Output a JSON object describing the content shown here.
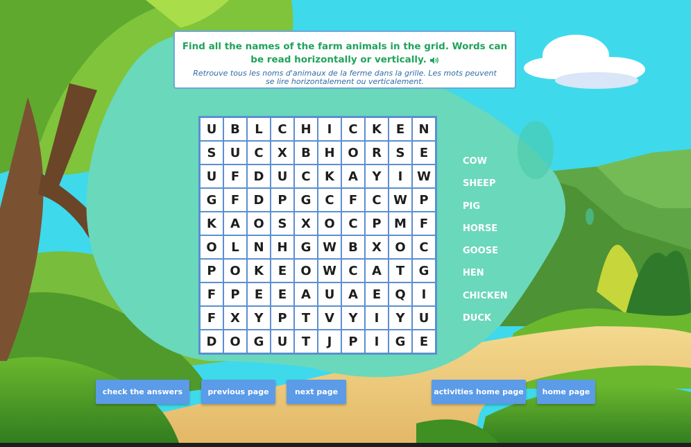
{
  "instructions": {
    "english": "Find all the names of the farm animals in the grid. Words can be read horizontally or vertically.",
    "french": "Retrouve tous les noms d'animaux de la ferme dans la grille. Les mots peuvent se lire horizontalement ou verticalement."
  },
  "grid": [
    [
      "U",
      "B",
      "L",
      "C",
      "H",
      "I",
      "C",
      "K",
      "E",
      "N"
    ],
    [
      "S",
      "U",
      "C",
      "X",
      "B",
      "H",
      "O",
      "R",
      "S",
      "E"
    ],
    [
      "U",
      "F",
      "D",
      "U",
      "C",
      "K",
      "A",
      "Y",
      "I",
      "W"
    ],
    [
      "G",
      "F",
      "D",
      "P",
      "G",
      "C",
      "F",
      "C",
      "W",
      "P"
    ],
    [
      "K",
      "A",
      "O",
      "S",
      "X",
      "O",
      "C",
      "P",
      "M",
      "F"
    ],
    [
      "O",
      "L",
      "N",
      "H",
      "G",
      "W",
      "B",
      "X",
      "O",
      "C"
    ],
    [
      "P",
      "O",
      "K",
      "E",
      "O",
      "W",
      "C",
      "A",
      "T",
      "G"
    ],
    [
      "F",
      "P",
      "E",
      "E",
      "A",
      "U",
      "A",
      "E",
      "Q",
      "I"
    ],
    [
      "F",
      "X",
      "Y",
      "P",
      "T",
      "V",
      "Y",
      "I",
      "Y",
      "U"
    ],
    [
      "D",
      "O",
      "G",
      "U",
      "T",
      "J",
      "P",
      "I",
      "G",
      "E"
    ]
  ],
  "words": [
    "COW",
    "SHEEP",
    "PIG",
    "HORSE",
    "GOOSE",
    "HEN",
    "CHICKEN",
    "DUCK"
  ],
  "buttons": {
    "check": "check the answers",
    "previous": "previous page",
    "next": "next page",
    "activities_home": "activities home page",
    "home": "home page"
  },
  "colors": {
    "instruction_english": "#1fa35a",
    "instruction_french": "#2f6aa6",
    "button": "#5b9be8",
    "grid_border": "#5b8fd0",
    "blob": "#6ad8bb",
    "sky": "#3fd9ec"
  },
  "icons": {
    "audio": "speaker-icon"
  }
}
